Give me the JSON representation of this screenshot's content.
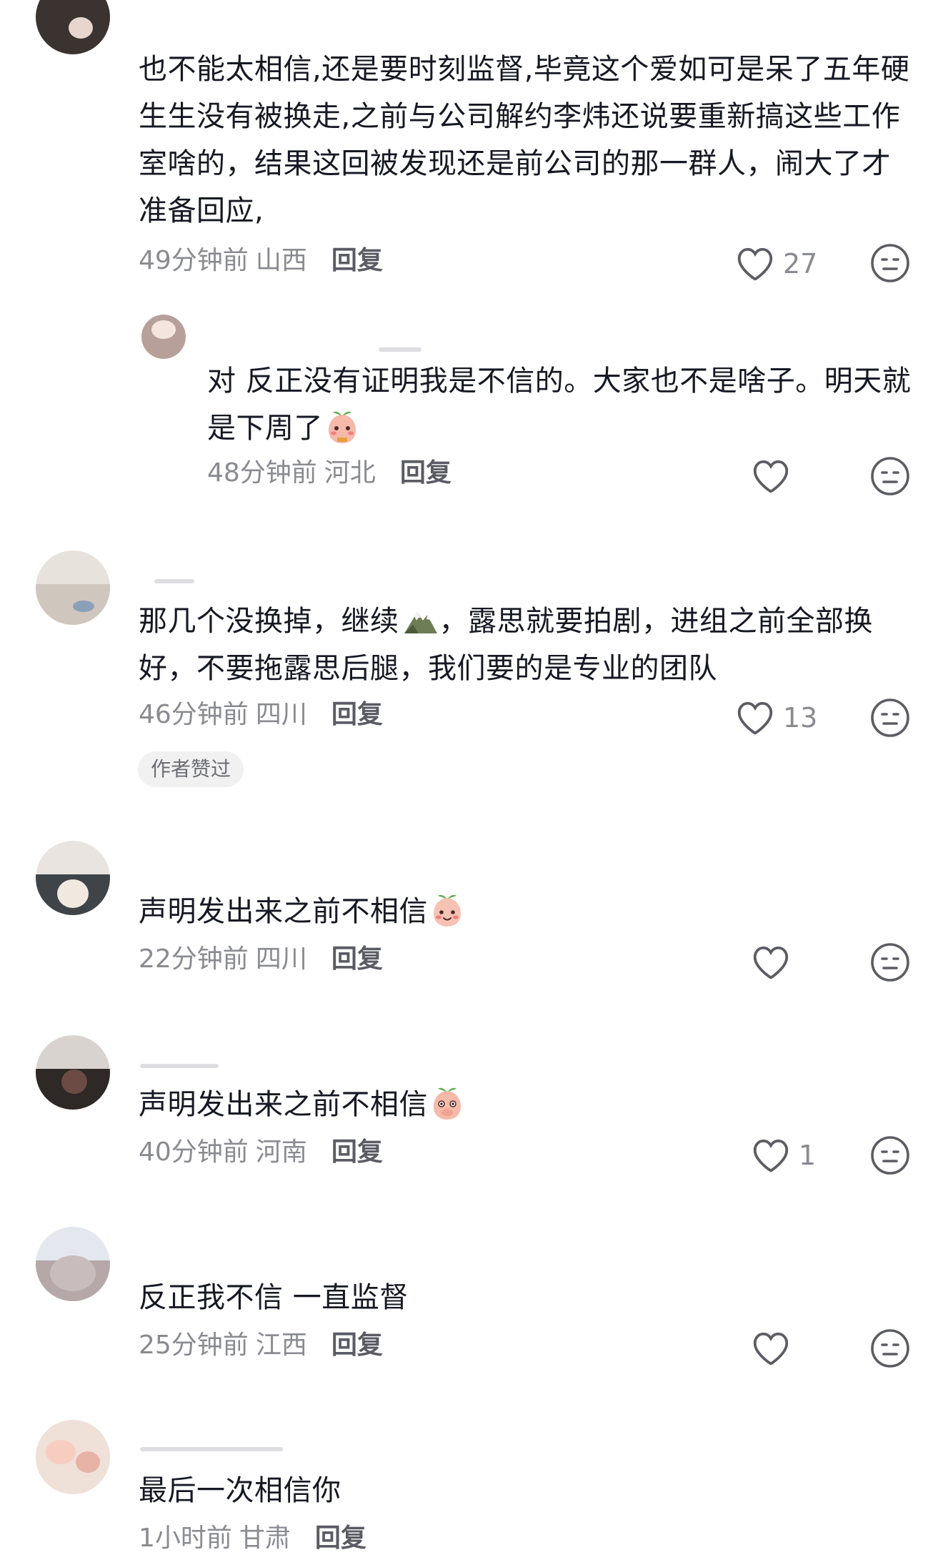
{
  "comments": [
    {
      "text": "也不能太相信,还是要时刻监督,毕竟这个爱如可是呆了五年硬生生没有被换走,之前与公司解约李炜还说要重新搞这些工作室啥的，结果这回被发现还是前公司的那一群人，闹大了才准备回应,",
      "time": "49分钟前",
      "location": "山西",
      "reply_label": "回复",
      "likes": "27"
    },
    {
      "text": "对 反正没有证明我是不信的。大家也不是啥子。明天就是下周了",
      "time": "48分钟前",
      "location": "河北",
      "reply_label": "回复",
      "likes": ""
    },
    {
      "text_before": "那几个没换掉，继续",
      "text_after": "，露思就要拍剧，进组之前全部换好，不要拖露思后腿，我们要的是专业的团队",
      "time": "46分钟前",
      "location": "四川",
      "reply_label": "回复",
      "likes": "13",
      "badge": "作者赞过"
    },
    {
      "text": "声明发出来之前不相信",
      "time": "22分钟前",
      "location": "四川",
      "reply_label": "回复",
      "likes": ""
    },
    {
      "text": "声明发出来之前不相信",
      "time": "40分钟前",
      "location": "河南",
      "reply_label": "回复",
      "likes": "1"
    },
    {
      "text": "反正我不信 一直监督",
      "time": "25分钟前",
      "location": "江西",
      "reply_label": "回复",
      "likes": ""
    },
    {
      "text": "最后一次相信你",
      "time": "1小时前",
      "location": "甘肃",
      "reply_label": "回复",
      "likes": ""
    }
  ],
  "icons": {
    "like": "heart-outline-icon",
    "dislike": "neutral-face-icon",
    "emoji_shy": "peach-shy-emoji",
    "emoji_mountain": "mountain-emoji",
    "emoji_smile": "peach-smile-emoji",
    "emoji_cover": "peach-cover-mouth-emoji"
  },
  "colors": {
    "text": "#161823",
    "meta": "#8a8b91",
    "icon": "#5c5d64"
  }
}
